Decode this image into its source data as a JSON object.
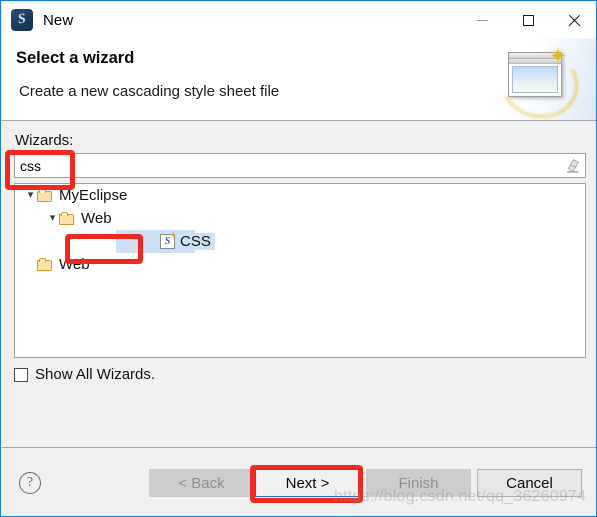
{
  "window": {
    "title": "New",
    "app_icon": "myeclipse-icon",
    "border_color": "#1a7ddb"
  },
  "titlebar_buttons": [
    {
      "name": "minimize-button",
      "icon": "minimize-icon"
    },
    {
      "name": "maximize-button",
      "icon": "maximize-icon"
    },
    {
      "name": "close-button",
      "icon": "close-icon"
    }
  ],
  "header": {
    "title": "Select a wizard",
    "subtitle": "Create a new cascading style sheet file",
    "banner_icon": "new-window-sparkle-icon"
  },
  "body": {
    "wizards_label": "Wizards:",
    "search": {
      "value": "css",
      "placeholder": "",
      "clear_icon": "eraser-icon"
    },
    "tree": [
      {
        "label": "MyEclipse",
        "level": 0,
        "icon": "folder-icon",
        "expanded": true,
        "chevron": "chevron-down-icon",
        "selected": false
      },
      {
        "label": "Web",
        "level": 1,
        "icon": "folder-icon",
        "expanded": true,
        "chevron": "chevron-down-icon",
        "selected": false
      },
      {
        "label": "CSS",
        "level": 2,
        "icon": "css-file-icon",
        "expanded": false,
        "chevron": "",
        "selected": true
      },
      {
        "label": "Web",
        "level": 0,
        "icon": "folder-icon",
        "expanded": false,
        "chevron": "",
        "selected": false
      }
    ],
    "show_all_wizards": {
      "label": "Show All Wizards.",
      "checked": false
    }
  },
  "footer": {
    "help_label": "?",
    "buttons": [
      {
        "id": "btn-back",
        "label": "< Back",
        "state": "disabled"
      },
      {
        "id": "btn-next",
        "label": "Next >",
        "state": "focused"
      },
      {
        "id": "btn-finish",
        "label": "Finish",
        "state": "disabled"
      },
      {
        "id": "btn-cancel",
        "label": "Cancel",
        "state": "normal"
      }
    ]
  },
  "annotations": {
    "color": "#ee2a20",
    "targets": [
      "search-input",
      "tree-item-css",
      "next-button"
    ]
  },
  "watermark": "https://blog.csdn.net/qq_36260974"
}
